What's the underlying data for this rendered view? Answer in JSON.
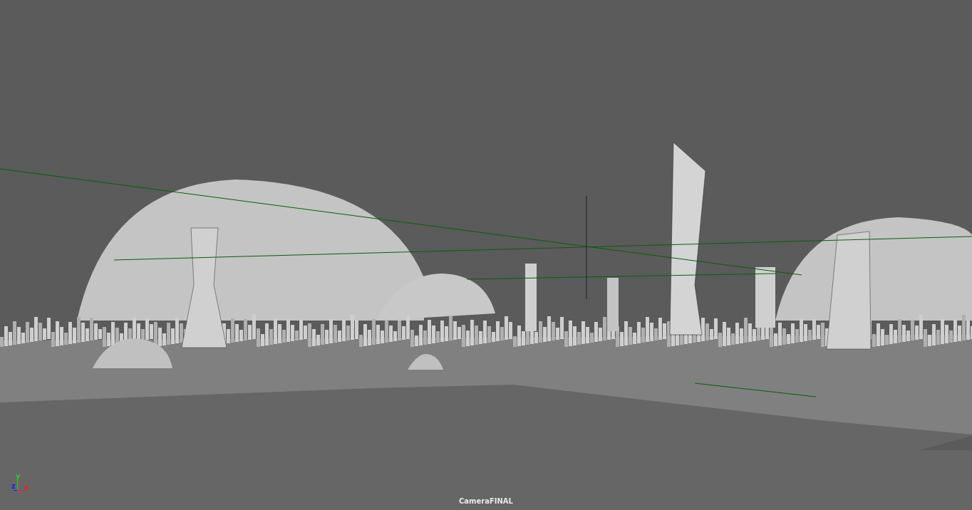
{
  "viewport": {
    "camera_name": "CameraFINAL",
    "axes": [
      {
        "label": "y",
        "color": "#22cc22",
        "kind": "up"
      },
      {
        "label": "z",
        "color": "#2222ee",
        "kind": "left"
      },
      {
        "label": "x",
        "color": "#ee2222",
        "kind": "right"
      }
    ]
  }
}
